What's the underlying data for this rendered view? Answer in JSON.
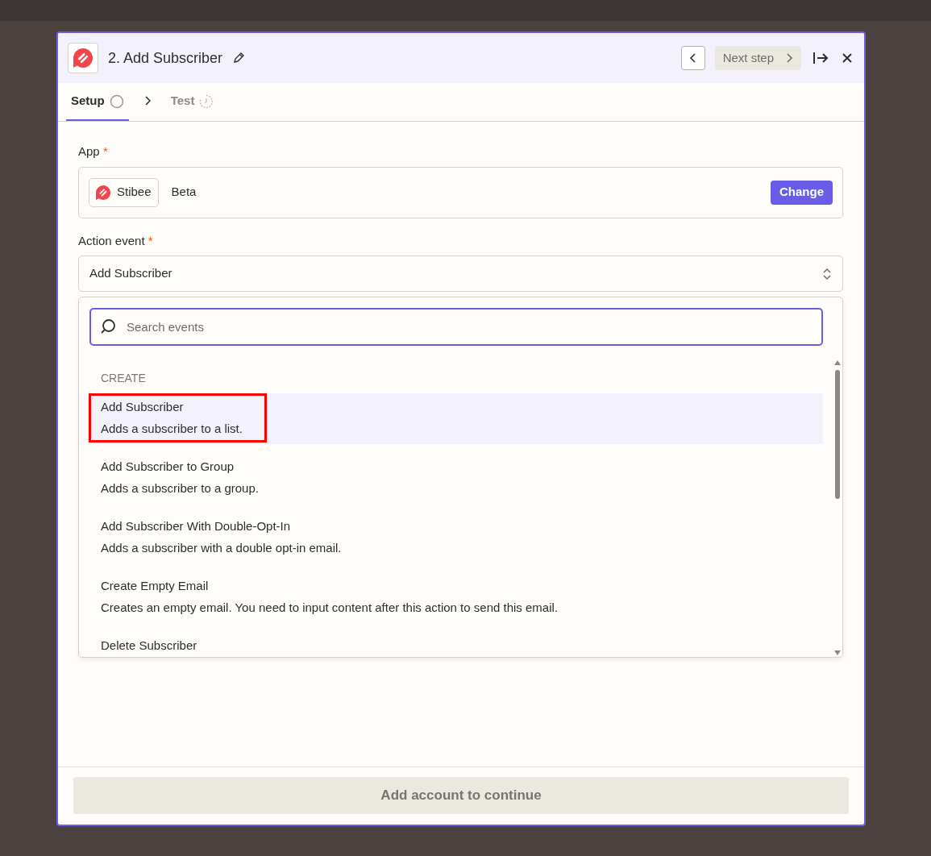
{
  "header": {
    "title": "2. Add Subscriber",
    "next_button": "Next step",
    "next_disabled": true
  },
  "tabs": [
    {
      "label": "Setup",
      "selected": true,
      "kind": "circle"
    },
    {
      "label": "Test",
      "selected": false,
      "kind": "timer"
    }
  ],
  "app_field": {
    "label": "App",
    "required_mark": "*",
    "app_name": "Stibee",
    "badge": "Beta",
    "button": "Change"
  },
  "event_field": {
    "label": "Action event",
    "required_mark": "*",
    "value": "Add Subscriber"
  },
  "dropdown": {
    "search": {
      "placeholder": "Search events"
    },
    "group": "CREATE",
    "items": [
      {
        "title": "Add Subscriber",
        "description": "Adds a subscriber to a list.",
        "selected": true,
        "annotated": true
      },
      {
        "title": "Add Subscriber to Group",
        "description": "Adds a subscriber to a group.",
        "selected": false,
        "annotated": false
      },
      {
        "title": "Add Subscriber With Double-Opt-In",
        "description": "Adds a subscriber with a double opt-in email.",
        "selected": false,
        "annotated": false
      },
      {
        "title": "Create Empty Email",
        "description": "Creates an empty email. You need to input content after this action to send this email.",
        "selected": false,
        "annotated": false
      },
      {
        "title": "Delete Subscriber",
        "selected": false,
        "annotated": false
      }
    ]
  },
  "footer": {
    "button": "Add account to continue",
    "disabled": true
  }
}
